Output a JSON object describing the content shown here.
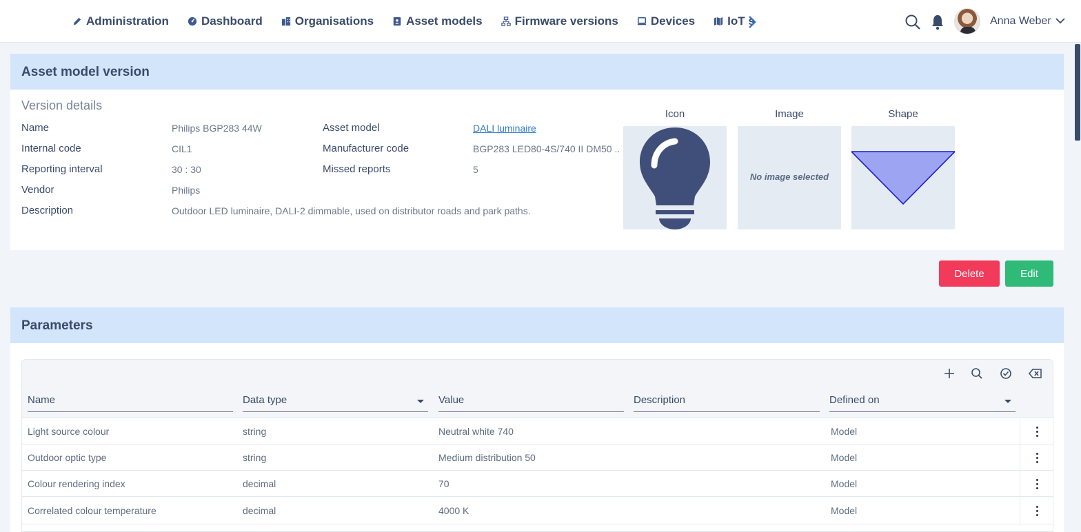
{
  "nav": {
    "items": [
      {
        "label": "Administration",
        "icon": "pencil-icon"
      },
      {
        "label": "Dashboard",
        "icon": "dashboard-gauge-icon"
      },
      {
        "label": "Organisations",
        "icon": "buildings-icon"
      },
      {
        "label": "Asset models",
        "icon": "address-book-icon"
      },
      {
        "label": "Firmware versions",
        "icon": "network-tree-icon"
      },
      {
        "label": "Devices",
        "icon": "device-icon"
      },
      {
        "label": "IoT s",
        "icon": "map-icon"
      }
    ],
    "next_icon": "chevron-right-icon"
  },
  "user": {
    "name": "Anna Weber"
  },
  "version_section": {
    "header": "Asset model version",
    "subtitle": "Version details",
    "fields": {
      "name_label": "Name",
      "name_value": "Philips BGP283 44W",
      "internal_code_label": "Internal code",
      "internal_code_value": "CIL1",
      "reporting_interval_label": "Reporting interval",
      "reporting_interval_value": "30 : 30",
      "vendor_label": "Vendor",
      "vendor_value": "Philips",
      "description_label": "Description",
      "description_value": "Outdoor LED luminaire, DALI-2 dimmable, used on distributor roads and park paths.",
      "asset_model_label": "Asset model",
      "asset_model_value": "DALI luminaire",
      "manufacturer_code_label": "Manufacturer code",
      "manufacturer_code_value": "BGP283 LED80-4S/740 II DM50 ...",
      "missed_reports_label": "Missed reports",
      "missed_reports_value": "5"
    },
    "media": {
      "icon_label": "Icon",
      "image_label": "Image",
      "shape_label": "Shape",
      "no_image_text": "No image selected"
    },
    "colors": {
      "bulb": "#3f4f7a",
      "shape_fill": "#9da4f2",
      "shape_stroke": "#1a1acc"
    }
  },
  "actions": {
    "delete_label": "Delete",
    "edit_label": "Edit",
    "delete_color": "#f23a5a",
    "edit_color": "#2fba77"
  },
  "parameters": {
    "header": "Parameters",
    "toolbar_icons": [
      "plus-icon",
      "search-icon",
      "check-circle-icon",
      "backspace-icon"
    ],
    "columns": [
      "Name",
      "Data type",
      "Value",
      "Description",
      "Defined on"
    ],
    "rows": [
      {
        "name": "Light source colour",
        "type": "string",
        "value": "Neutral white 740",
        "description": "",
        "defined_on": "Model"
      },
      {
        "name": "Outdoor optic type",
        "type": "string",
        "value": "Medium distribution 50",
        "description": "",
        "defined_on": "Model"
      },
      {
        "name": "Colour rendering index",
        "type": "decimal",
        "value": "70",
        "description": "",
        "defined_on": "Model"
      },
      {
        "name": "Correlated colour temperature",
        "type": "decimal",
        "value": "4000 K",
        "description": "",
        "defined_on": "Model"
      }
    ]
  }
}
